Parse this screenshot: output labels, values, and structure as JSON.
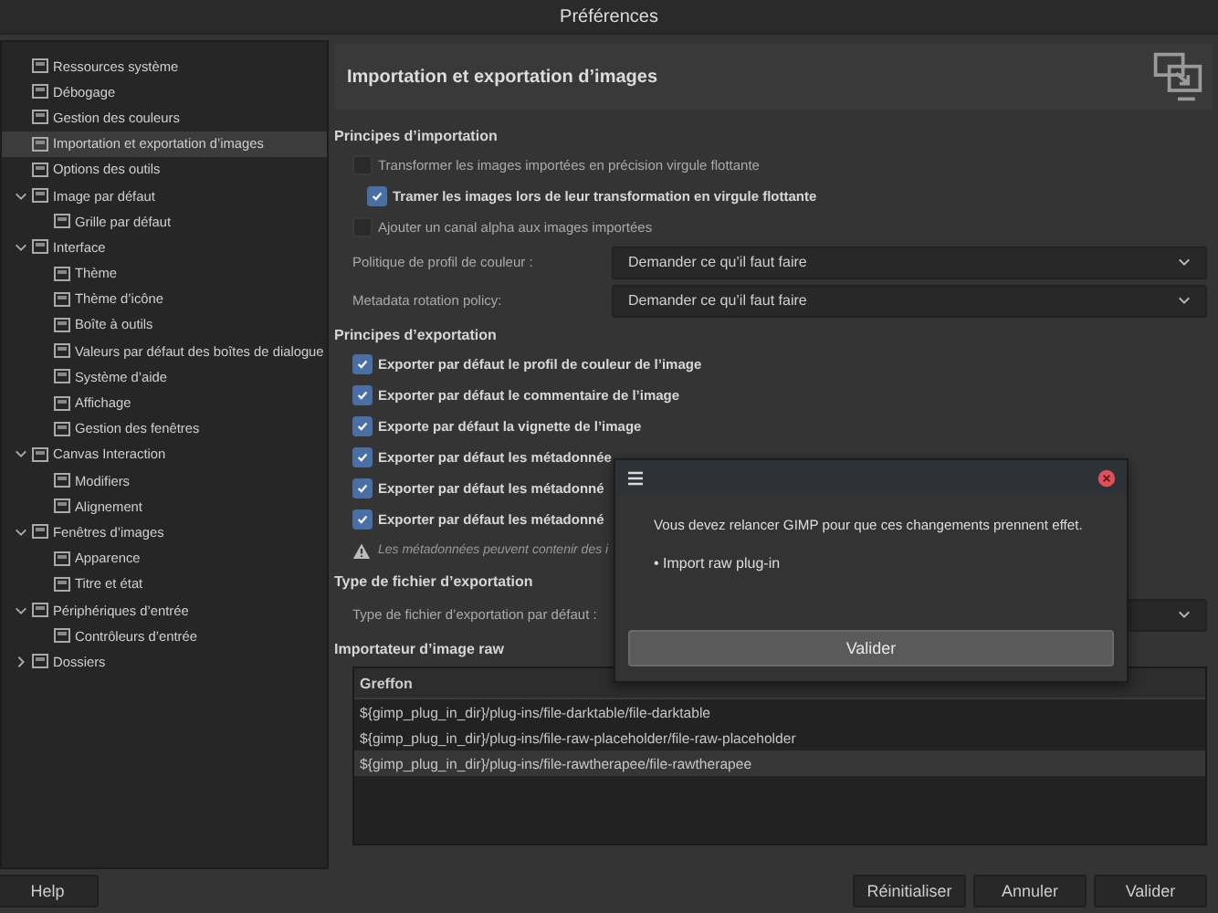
{
  "window": {
    "title": "Préférences"
  },
  "sidebar": {
    "items": [
      {
        "label": "Ressources système",
        "selected": false
      },
      {
        "label": "Débogage",
        "selected": false
      },
      {
        "label": "Gestion des couleurs",
        "selected": false
      },
      {
        "label": "Importation et exportation d’images",
        "selected": true
      },
      {
        "label": "Options des outils",
        "selected": false
      },
      {
        "label": "Image par défaut",
        "selected": false,
        "expanded": true,
        "children": [
          {
            "label": "Grille par défaut",
            "selected": false
          }
        ]
      },
      {
        "label": "Interface",
        "selected": false,
        "expanded": true,
        "children": [
          {
            "label": "Thème",
            "selected": false
          },
          {
            "label": "Thème d’icône",
            "selected": false
          },
          {
            "label": "Boîte à outils",
            "selected": false
          },
          {
            "label": "Valeurs par défaut des boîtes de dialogue",
            "selected": false
          },
          {
            "label": "Système d’aide",
            "selected": false
          },
          {
            "label": "Affichage",
            "selected": false
          },
          {
            "label": "Gestion des fenêtres",
            "selected": false
          }
        ]
      },
      {
        "label": "Canvas Interaction",
        "selected": false,
        "expanded": true,
        "children": [
          {
            "label": "Modifiers",
            "selected": false
          },
          {
            "label": "Alignement",
            "selected": false
          }
        ]
      },
      {
        "label": "Fenêtres d’images",
        "selected": false,
        "expanded": true,
        "children": [
          {
            "label": "Apparence",
            "selected": false
          },
          {
            "label": "Titre et état",
            "selected": false
          }
        ]
      },
      {
        "label": "Périphériques d’entrée",
        "selected": false,
        "expanded": true,
        "children": [
          {
            "label": "Contrôleurs d’entrée",
            "selected": false
          }
        ]
      },
      {
        "label": "Dossiers",
        "selected": false,
        "expanded": false
      }
    ]
  },
  "page": {
    "title": "Importation et exportation d’images",
    "import": {
      "heading": "Principes d’importation",
      "options": [
        {
          "label": "Transformer les images importées en précision virgule flottante",
          "checked": false,
          "children": [
            {
              "label": "Tramer les images lors de leur transformation en virgule flottante",
              "checked": true
            }
          ]
        },
        {
          "label": "Ajouter un canal alpha aux images importées",
          "checked": false
        }
      ],
      "combos": [
        {
          "label": "Politique de profil de couleur :",
          "value": "Demander ce qu’il faut faire"
        },
        {
          "label": "Metadata rotation policy:",
          "value": "Demander ce qu’il faut faire"
        }
      ]
    },
    "export": {
      "heading": "Principes d’exportation",
      "options": [
        {
          "label": "Exporter par défaut le profil de couleur de l’image",
          "checked": true
        },
        {
          "label": "Exporter par défaut le commentaire de l’image",
          "checked": true
        },
        {
          "label": "Exporte par défaut la vignette de l’image",
          "checked": true
        },
        {
          "label": "Exporter par défaut les métadonnée",
          "checked": true
        },
        {
          "label": "Exporter par défaut les métadonné",
          "checked": true
        },
        {
          "label": "Exporter par défaut les métadonné",
          "checked": true
        }
      ],
      "warning": "Les métadonnées peuvent contenir des i"
    },
    "file_type": {
      "heading": "Type de fichier d’exportation",
      "combo_label": "Type de fichier d’exportation par défaut :"
    },
    "raw": {
      "heading": "Importateur d’image raw",
      "column": "Greffon",
      "rows": [
        {
          "path": "${gimp_plug_in_dir}/plug-ins/file-darktable/file-darktable",
          "selected": false
        },
        {
          "path": "${gimp_plug_in_dir}/plug-ins/file-raw-placeholder/file-raw-placeholder",
          "selected": false
        },
        {
          "path": "${gimp_plug_in_dir}/plug-ins/file-rawtherapee/file-rawtherapee",
          "selected": true
        }
      ]
    }
  },
  "buttons": {
    "help": "Help",
    "actions": [
      "Réinitialiser",
      "Annuler",
      "Valider"
    ]
  },
  "dialog": {
    "message": "Vous devez relancer GIMP pour que ces changements prennent effet.",
    "item": "• Import raw plug-in",
    "button": "Valider"
  }
}
